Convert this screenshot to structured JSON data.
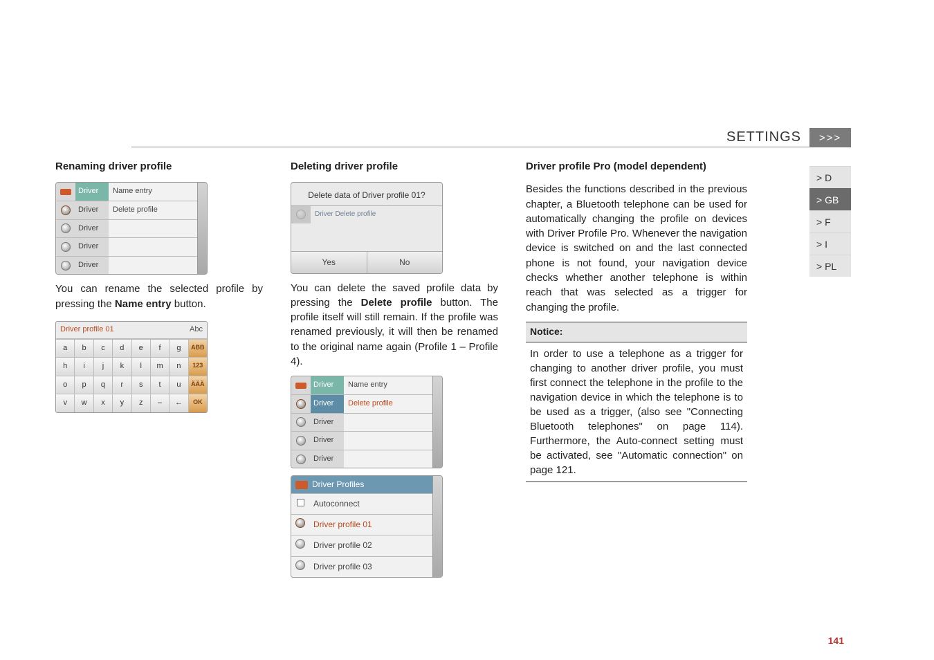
{
  "header": {
    "title": "SETTINGS",
    "chevrons": ">>>"
  },
  "sideTabs": [
    "> D",
    "> GB",
    "> F",
    "> I",
    "> PL"
  ],
  "sideActive": 1,
  "col1": {
    "title": "Renaming driver profile",
    "list": {
      "rows": [
        {
          "label": "Driver",
          "value": "Name entry",
          "hl": "green"
        },
        {
          "label": "Driver",
          "value": "Delete profile",
          "hl": "none-sel"
        },
        {
          "label": "Driver",
          "value": ""
        },
        {
          "label": "Driver",
          "value": ""
        },
        {
          "label": "Driver",
          "value": ""
        }
      ]
    },
    "para1a": "You can rename the selected profile by pressing the ",
    "para1b": "Name entry",
    "para1c": " button.",
    "kb": {
      "headLeft": "Driver profile 01",
      "headRight": "Abc",
      "rows": [
        [
          "a",
          "b",
          "c",
          "d",
          "e",
          "f",
          "g",
          "ABB"
        ],
        [
          "h",
          "i",
          "j",
          "k",
          "l",
          "m",
          "n",
          "123"
        ],
        [
          "o",
          "p",
          "q",
          "r",
          "s",
          "t",
          "u",
          "ÄÄÄ"
        ],
        [
          "v",
          "w",
          "x",
          "y",
          "z",
          "–",
          "←",
          "OK"
        ]
      ]
    }
  },
  "col2": {
    "title": "Deleting driver profile",
    "dialog": {
      "title": "Delete data of Driver profile 01?",
      "ghost": "Driver   Delete profile",
      "yes": "Yes",
      "no": "No"
    },
    "para1a": "You can delete the saved profile data by pressing the ",
    "para1b": "Delete profile",
    "para1c": " button. The profile itself will still remain. If the profile was renamed previously, it will then be renamed to the original name again (Profile 1 – Profile 4).",
    "list": {
      "rows": [
        {
          "label": "Driver",
          "value": "Name entry",
          "hl": "green"
        },
        {
          "label": "Driver",
          "value": "Delete profile",
          "hl": "sel"
        },
        {
          "label": "Driver",
          "value": ""
        },
        {
          "label": "Driver",
          "value": ""
        },
        {
          "label": "Driver",
          "value": ""
        }
      ]
    },
    "list2": {
      "head": "Driver Profiles",
      "rows": [
        {
          "icon": "check",
          "text": "Autoconnect"
        },
        {
          "icon": "wheel-hl",
          "text": "Driver profile 01",
          "hl": true
        },
        {
          "icon": "wheel",
          "text": "Driver profile 02"
        },
        {
          "icon": "wheel",
          "text": "Driver profile 03"
        }
      ]
    }
  },
  "col3": {
    "title": "Driver profile Pro (model dependent)",
    "para1": "Besides the functions described in the previous chapter, a Bluetooth telephone can be used for automatically changing the profile on devices with Driver Profile Pro. Whenever the navigation device is switched on and the last connected phone is not found, your navigation device checks whether another telephone is within reach that was selected as a trigger for changing the profile.",
    "noticeHead": "Notice:",
    "noticeBody": "In order to use a telephone as a trigger for changing to another driver profile, you must first connect the telephone in the profile to the navigation device in which the telephone is to be used as a trigger, (also see \"Connecting Bluetooth telephones\" on page 114).\nFurthermore, the Auto-connect setting must be activated, see \"Automatic connection\" on page 121."
  },
  "pageNumber": "141"
}
